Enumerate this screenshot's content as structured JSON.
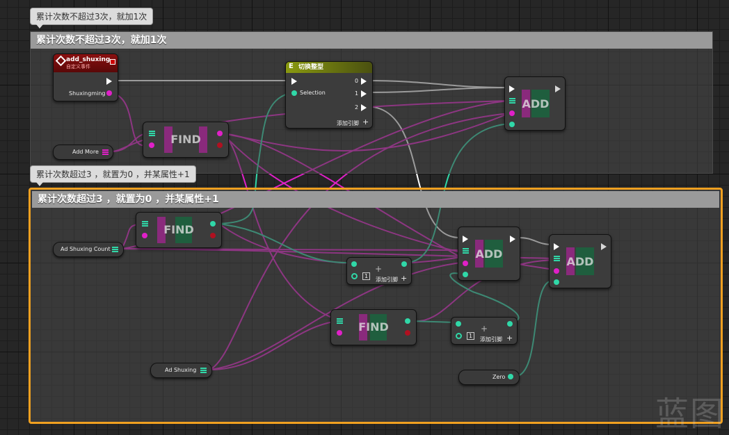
{
  "comments": {
    "top_bubble": "累计次数不超过3次，就加1次",
    "top_header": "累计次数不超过3次，就加1次",
    "bottom_bubble": "累计次数超过3 ，就置为0 ，并某属性+1",
    "bottom_header": "累计次数超过3 ，就置为0 ，并某属性+1"
  },
  "nodes": {
    "custom_event": {
      "title": "add_shuxing",
      "subtitle": "自定义事件",
      "pin": "Shuxingming"
    },
    "switch": {
      "title": "切换整型",
      "selection": "Selection",
      "out0": "0",
      "out1": "1",
      "out2": "2",
      "add_pin": "添加引脚"
    },
    "find": "FIND",
    "add": "ADD",
    "make_array_add_pin": "添加引脚",
    "make_array_index": "1",
    "vars": {
      "add_more": "Add More",
      "ad_shuxing_count": "Ad Shuxing Count",
      "ad_shuxing": "Ad Shuxing",
      "zero": "Zero"
    }
  },
  "colors": {
    "exec": "#ffffff",
    "string": "#e020c8",
    "integer": "#30d8a8",
    "bool": "#b01020",
    "selection": "#f0a020"
  },
  "watermark": "蓝图"
}
